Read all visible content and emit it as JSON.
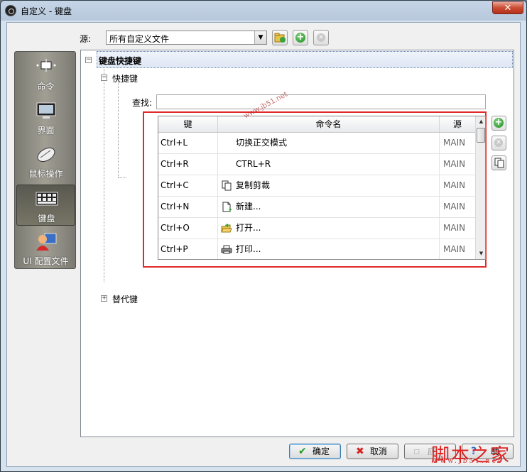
{
  "window": {
    "title": "自定义 - 键盘",
    "close_glyph": "✕"
  },
  "source": {
    "label": "源:",
    "value": "所有自定义文件"
  },
  "categories": [
    {
      "label": "命令",
      "icon": "command-icon"
    },
    {
      "label": "界面",
      "icon": "monitor-icon"
    },
    {
      "label": "鼠标操作",
      "icon": "mouse-icon"
    },
    {
      "label": "键盘",
      "icon": "keyboard-icon",
      "active": true
    },
    {
      "label": "UI 配置文件",
      "icon": "user-profile-icon"
    }
  ],
  "tree": {
    "root": "键盘快捷键",
    "shortcuts": "快捷键",
    "alternates": "替代键",
    "expanded_glyph": "−",
    "collapsed_glyph": "+"
  },
  "find": {
    "label": "查找:",
    "value": ""
  },
  "grid": {
    "columns": [
      "键",
      "命令名",
      "源"
    ],
    "rows": [
      {
        "key": "Ctrl+L",
        "command": "切换正交模式",
        "source": "MAIN",
        "icon": ""
      },
      {
        "key": "Ctrl+R",
        "command": "CTRL+R",
        "source": "MAIN",
        "icon": ""
      },
      {
        "key": "Ctrl+C",
        "command": "复制剪裁",
        "source": "MAIN",
        "icon": "copy-icon"
      },
      {
        "key": "Ctrl+N",
        "command": "新建...",
        "source": "MAIN",
        "icon": "new-file-icon"
      },
      {
        "key": "Ctrl+O",
        "command": "打开...",
        "source": "MAIN",
        "icon": "open-folder-icon"
      },
      {
        "key": "Ctrl+P",
        "command": "打印...",
        "source": "MAIN",
        "icon": "printer-icon"
      }
    ]
  },
  "buttons": {
    "ok": "确定",
    "cancel": "取消",
    "apply": "应",
    "help": "助"
  },
  "watermark": {
    "main": "脚本之家",
    "url": "www.jb51.net",
    "corner": "www.jb51.net"
  },
  "colors": {
    "highlight": "#e02a2a",
    "add": "#1e8a1e"
  }
}
